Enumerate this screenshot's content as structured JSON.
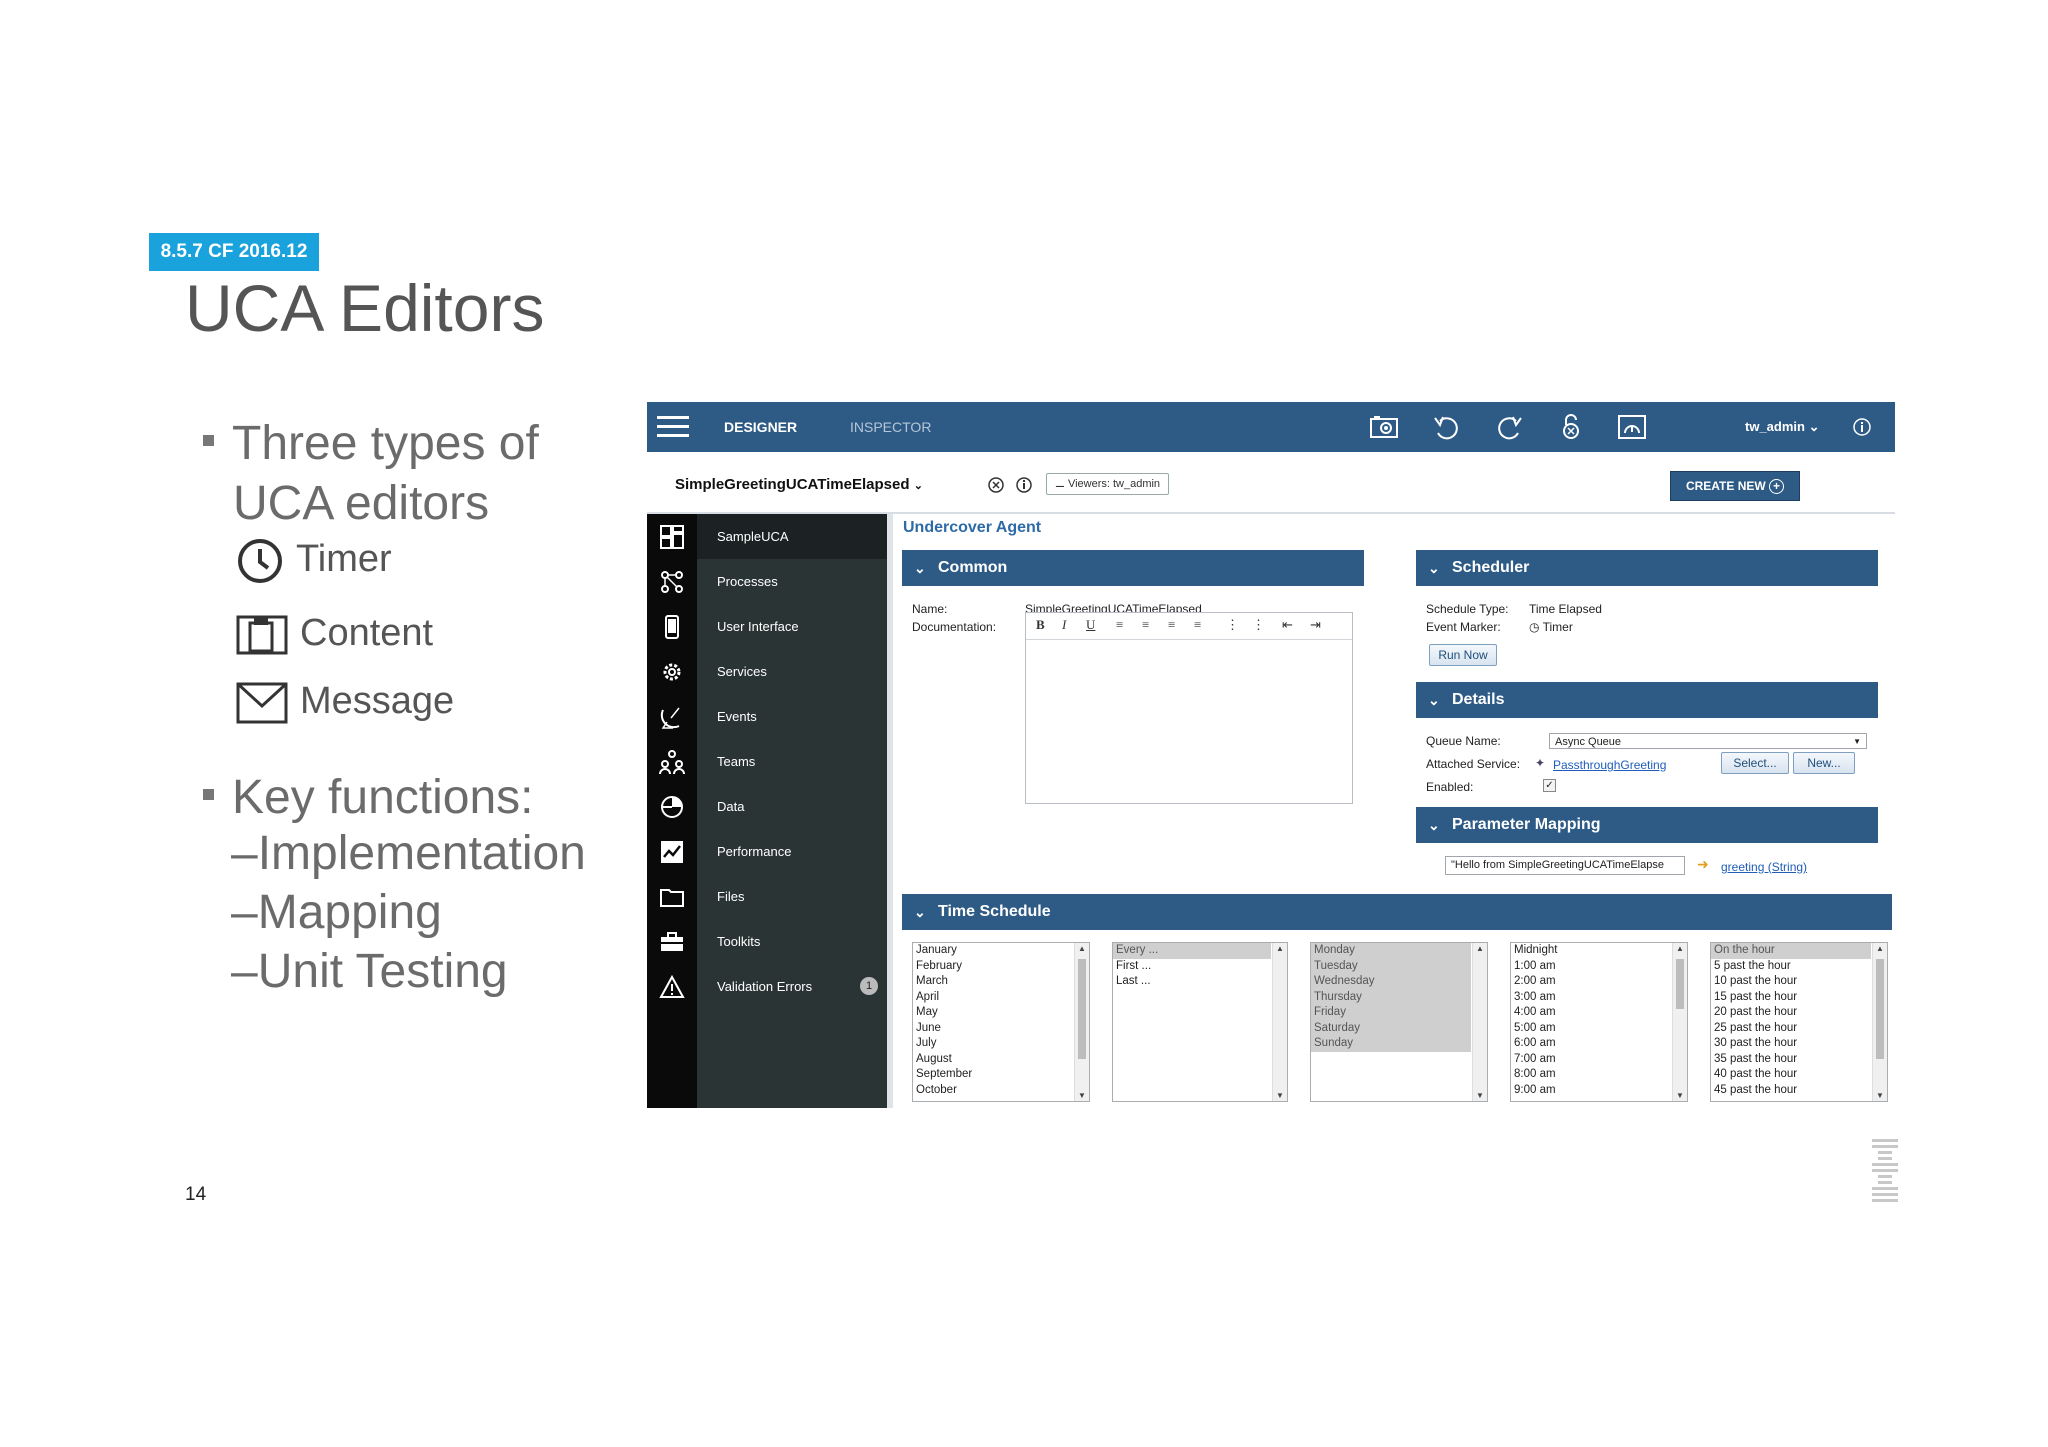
{
  "slide": {
    "badge": "8.5.7 CF 2016.12",
    "title": "UCA Editors",
    "bullet1_line1": "Three types of",
    "bullet1_line2": "UCA editors",
    "types": [
      "Timer",
      "Content",
      "Message"
    ],
    "bullet2": "Key functions:",
    "functions": [
      "Implementation",
      "Mapping",
      "Unit Testing"
    ],
    "page_number": "14"
  },
  "app": {
    "tabs": {
      "designer": "DESIGNER",
      "inspector": "INSPECTOR"
    },
    "user": "tw_admin",
    "process_name": "SimpleGreetingUCATimeElapsed",
    "viewers": "Viewers: tw_admin",
    "create_new": "CREATE NEW",
    "nav": {
      "items": [
        "SampleUCA",
        "Processes",
        "User Interface",
        "Services",
        "Events",
        "Teams",
        "Data",
        "Performance",
        "Files",
        "Toolkits",
        "Validation Errors"
      ],
      "validation_count": "1"
    },
    "main_title": "Undercover Agent",
    "common": {
      "header": "Common",
      "name_label": "Name:",
      "name_value": "SimpleGreetingUCATimeElapsed",
      "doc_label": "Documentation:"
    },
    "scheduler": {
      "header": "Scheduler",
      "schedule_type_label": "Schedule Type:",
      "schedule_type_value": "Time Elapsed",
      "event_marker_label": "Event Marker:",
      "event_marker_value": "Timer",
      "run_now": "Run Now"
    },
    "details": {
      "header": "Details",
      "queue_label": "Queue Name:",
      "queue_value": "Async Queue",
      "service_label": "Attached Service:",
      "service_value": "PassthroughGreeting",
      "select_btn": "Select...",
      "new_btn": "New...",
      "enabled_label": "Enabled:"
    },
    "param_mapping": {
      "header": "Parameter Mapping",
      "input_value": "\"Hello from SimpleGreetingUCATimeElapse",
      "target": "greeting (String)"
    },
    "time_schedule": {
      "header": "Time Schedule",
      "months": [
        "January",
        "February",
        "March",
        "April",
        "May",
        "June",
        "July",
        "August",
        "September",
        "October"
      ],
      "frequency": [
        "Every ...",
        "First ...",
        "Last ..."
      ],
      "days": [
        "Monday",
        "Tuesday",
        "Wednesday",
        "Thursday",
        "Friday",
        "Saturday",
        "Sunday"
      ],
      "hours": [
        "Midnight",
        "1:00 am",
        "2:00 am",
        "3:00 am",
        "4:00 am",
        "5:00 am",
        "6:00 am",
        "7:00 am",
        "8:00 am",
        "9:00 am"
      ],
      "minutes": [
        "On the hour",
        "5 past the hour",
        "10 past the hour",
        "15 past the hour",
        "20 past the hour",
        "25 past the hour",
        "30 past the hour",
        "35 past the hour",
        "40 past the hour",
        "45 past the hour"
      ]
    },
    "colors": {
      "header_blue": "#2e5b85",
      "nav_dark": "#2b3435",
      "badge_cyan": "#1aa2dc"
    }
  }
}
